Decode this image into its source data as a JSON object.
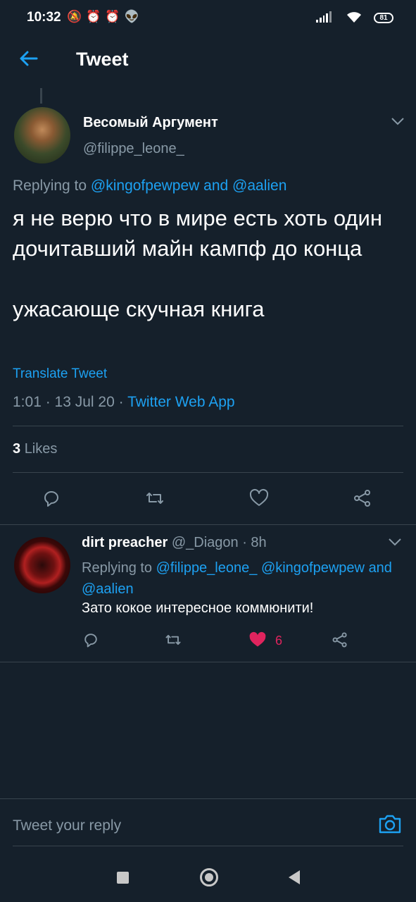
{
  "status_bar": {
    "time": "10:32",
    "icons": [
      "mute-bell-icon",
      "alarm-icon",
      "alarm-icon",
      "reddit-icon"
    ],
    "battery": "81"
  },
  "header": {
    "title": "Tweet"
  },
  "main_tweet": {
    "author_name": "Весомый Аргумент",
    "author_handle": "@filippe_leone_",
    "replying_prefix": "Replying to",
    "replying_to_1": "@kingofpewpew",
    "replying_and": "and",
    "replying_to_2": "@aalien",
    "text": "я не верю что в мире есть хоть один дочитавший майн кампф до конца\n\nужасающе скучная книга",
    "translate_label": "Translate Tweet",
    "timestamp": "1:01 · 13 Jul 20 · ",
    "source": "Twitter Web App",
    "likes_count": "3",
    "likes_label": "Likes"
  },
  "reply_tweet": {
    "author_name": "dirt preacher",
    "author_handle": "@_Diagon",
    "time": "· 8h",
    "replying_prefix": "Replying to",
    "replying_to_1": "@filippe_leone_",
    "replying_to_2": "@kingofpewpew",
    "replying_and": "and",
    "replying_to_3": "@aalien",
    "text": "Зато кокое интересное коммюнити!",
    "like_count": "6"
  },
  "composer": {
    "placeholder": "Tweet your reply"
  },
  "colors": {
    "background": "#15202b",
    "accent": "#1da1f2",
    "muted": "#8899a6",
    "like": "#e0245e",
    "divider": "#38444d"
  }
}
